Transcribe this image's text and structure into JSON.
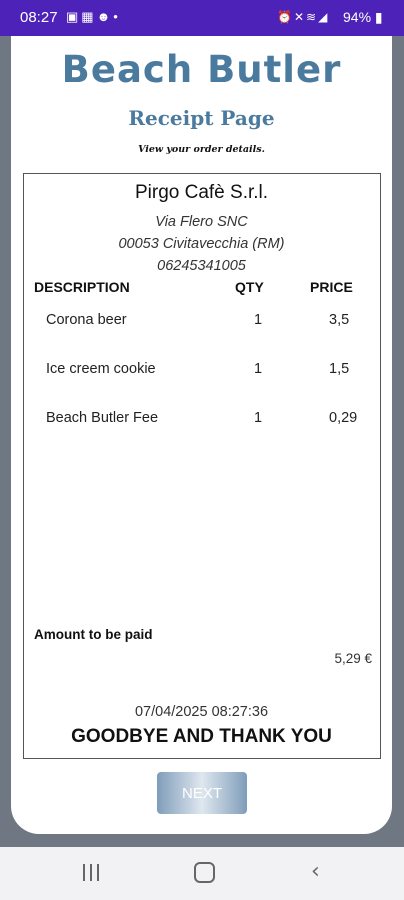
{
  "status_bar": {
    "time": "08:27",
    "left_icons": [
      "image-icon",
      "photos-icon",
      "chat-icon",
      "dot-icon"
    ],
    "right_icons": [
      "alarm-icon",
      "mute-icon",
      "wifi-icon",
      "signal-icon"
    ],
    "battery": "94%"
  },
  "header": {
    "app_title": "Beach Butler",
    "page_title": "Receipt Page",
    "subtitle": "View your order details."
  },
  "receipt": {
    "shop_name": "Pirgo Cafè S.r.l.",
    "address_line1": "Via Flero SNC",
    "address_line2": "00053 Civitavecchia (RM)",
    "phone": "06245341005",
    "columns": [
      "DESCRIPTION",
      "QTY",
      "PRICE"
    ],
    "items": [
      {
        "description": "Corona beer",
        "qty": "1",
        "price": "3,5"
      },
      {
        "description": "Ice creem cookie",
        "qty": "1",
        "price": "1,5"
      },
      {
        "description": "Beach Butler Fee",
        "qty": "1",
        "price": "0,29"
      }
    ],
    "amount_label": "Amount to be paid",
    "amount_value": "5,29 €",
    "datetime": "07/04/2025 08:27:36",
    "goodbye": "GOODBYE AND THANK YOU"
  },
  "next_button": {
    "label": "NEXT"
  },
  "nav_bar": {
    "icons": [
      "recents-icon",
      "home-icon",
      "back-icon"
    ]
  },
  "colors": {
    "status_bar": "#4d22b8",
    "title_blue": "#4b7a9f",
    "frame": "#6e7782"
  }
}
